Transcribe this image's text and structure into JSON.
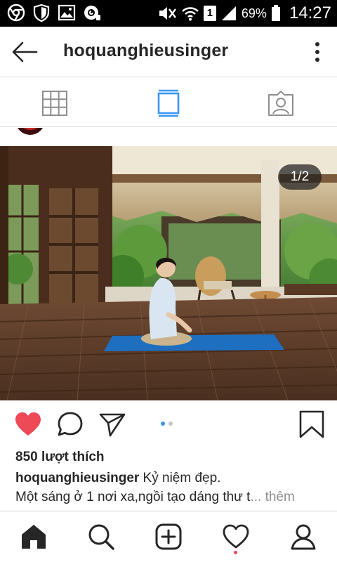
{
  "status_bar": {
    "battery_percent": "69%",
    "time": "14:27",
    "sim_label": "1",
    "icons": [
      "chrome-icon",
      "shield-icon",
      "gallery-icon",
      "cleaner-icon",
      "mute-icon",
      "wifi-icon",
      "sim-icon",
      "signal-icon",
      "battery-icon"
    ]
  },
  "header": {
    "title": "hoquanghieusinger",
    "back_icon": "arrow-left-icon",
    "more_icon": "more-vertical-icon"
  },
  "tabs": [
    {
      "name": "grid",
      "icon": "grid-icon",
      "active": false
    },
    {
      "name": "feed",
      "icon": "feed-icon",
      "active": true
    },
    {
      "name": "tagged",
      "icon": "tagged-icon",
      "active": false
    }
  ],
  "post": {
    "page_indicator": "1/2",
    "carousel_count": 2,
    "carousel_active": 1,
    "likes_text": "850 lượt thích",
    "caption_user": "hoquanghieusinger",
    "caption_text": " Kỷ niệm đẹp.",
    "caption_line2": "Một sáng ở 1 nơi xa,ngồi tạo dáng thư t",
    "more_text": "... thêm",
    "liked": true
  },
  "bottom_nav": [
    {
      "name": "home",
      "icon": "home-icon",
      "active": true
    },
    {
      "name": "search",
      "icon": "search-icon"
    },
    {
      "name": "add",
      "icon": "add-post-icon"
    },
    {
      "name": "activity",
      "icon": "heart-outline-icon",
      "has_notification": true
    },
    {
      "name": "profile",
      "icon": "profile-icon"
    }
  ],
  "colors": {
    "like_red": "#ed4956",
    "active_blue": "#3897f0",
    "text": "#262626",
    "muted": "#8e8e8e",
    "divider": "#dbdbdb",
    "yoga_mat": "#1e6fc0"
  }
}
